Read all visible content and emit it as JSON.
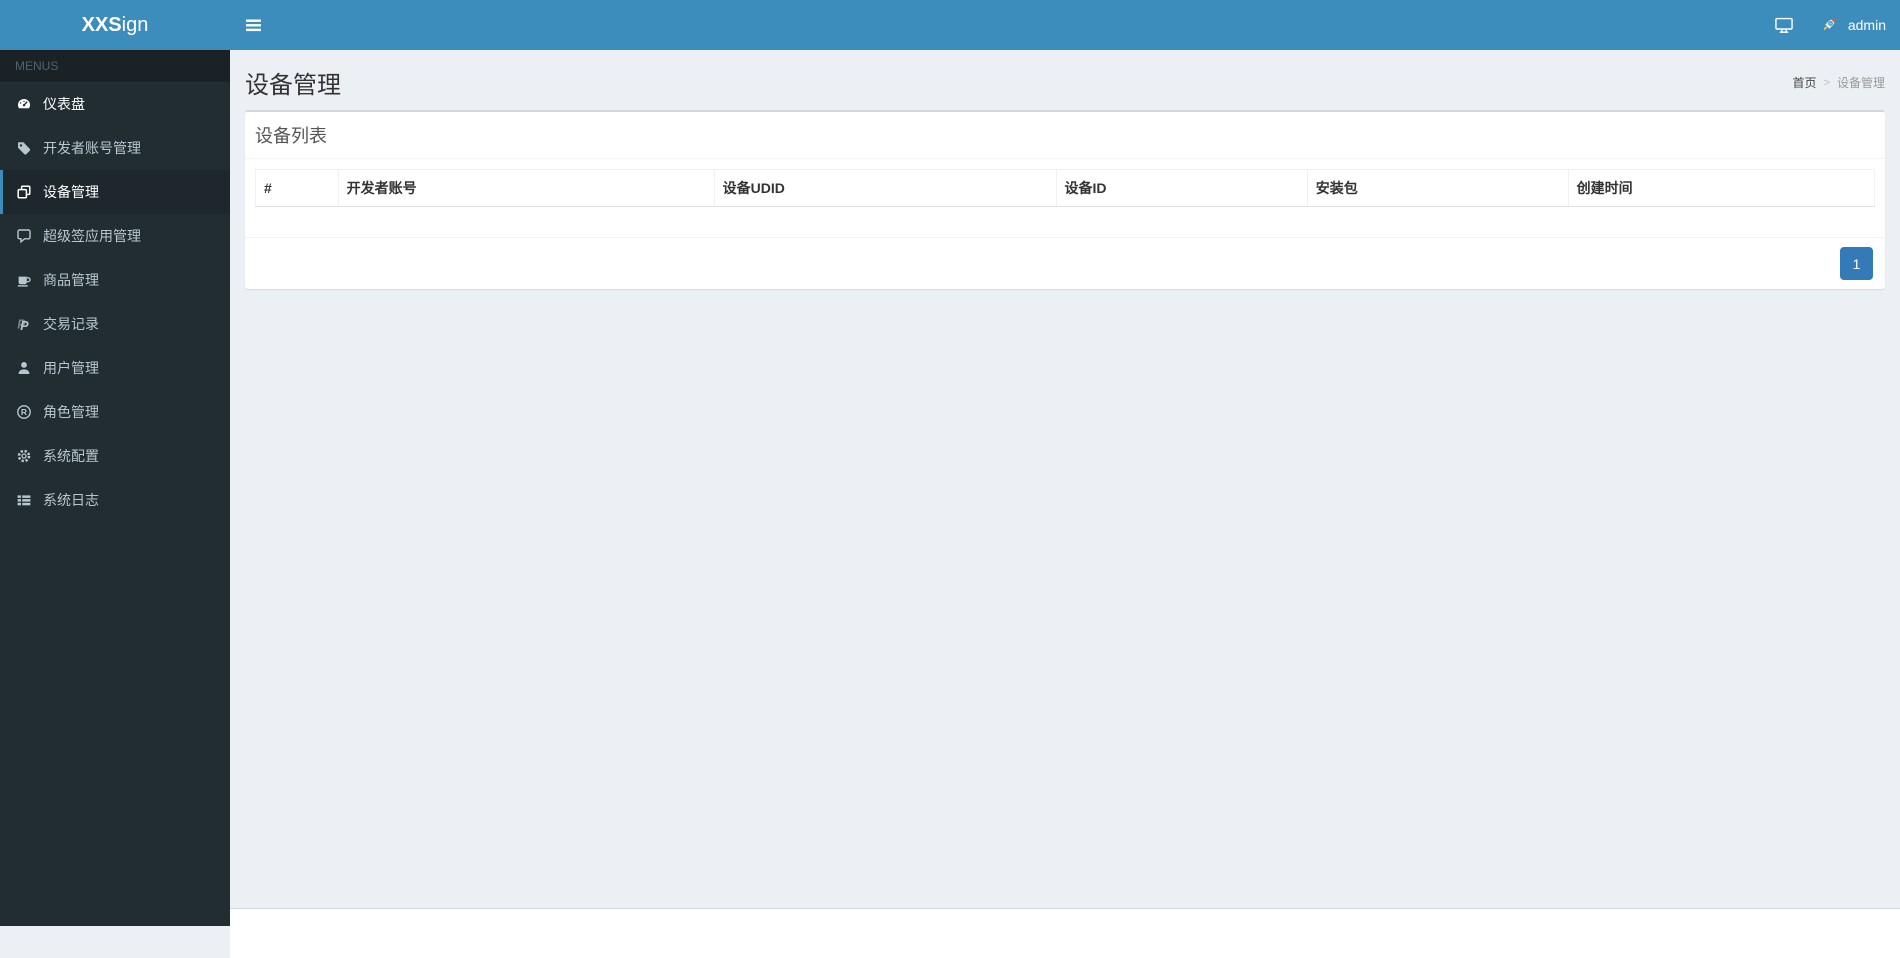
{
  "app": {
    "logo_bold": "XXS",
    "logo_rest": "ign",
    "username": "admin"
  },
  "sidebar": {
    "section_header": "MENUS",
    "items": [
      {
        "label": "仪表盘",
        "icon": "tachometer-icon",
        "active": false
      },
      {
        "label": "开发者账号管理",
        "icon": "tag-icon",
        "active": false
      },
      {
        "label": "设备管理",
        "icon": "clone-icon",
        "active": true
      },
      {
        "label": "超级签应用管理",
        "icon": "comment-icon",
        "active": false
      },
      {
        "label": "商品管理",
        "icon": "coffee-icon",
        "active": false
      },
      {
        "label": "交易记录",
        "icon": "paypal-icon",
        "active": false
      },
      {
        "label": "用户管理",
        "icon": "user-icon",
        "active": false
      },
      {
        "label": "角色管理",
        "icon": "registered-icon",
        "active": false
      },
      {
        "label": "系统配置",
        "icon": "gear-icon",
        "active": false
      },
      {
        "label": "系统日志",
        "icon": "list-icon",
        "active": false
      }
    ]
  },
  "header": {
    "page_title": "设备管理",
    "breadcrumb": {
      "home": "首页",
      "separator": ">",
      "current": "设备管理"
    }
  },
  "main": {
    "box_title": "设备列表",
    "table": {
      "columns": [
        "#",
        "开发者账号",
        "设备UDID",
        "设备ID",
        "安装包",
        "创建时间"
      ],
      "rows": []
    },
    "pagination": {
      "current": "1"
    }
  },
  "colors": {
    "navbar": "#3c8dbc",
    "navbar_hover": "#367fa9",
    "sidebar_bg": "#222d32",
    "sidebar_header_bg": "#1a2226",
    "sidebar_text": "#b8c7ce",
    "active_item_bg": "#1e282c",
    "active_item_border": "#3c8dbc",
    "content_bg": "#ecf0f5",
    "pagination_active": "#337ab7",
    "card_bg": "#ffffff"
  }
}
